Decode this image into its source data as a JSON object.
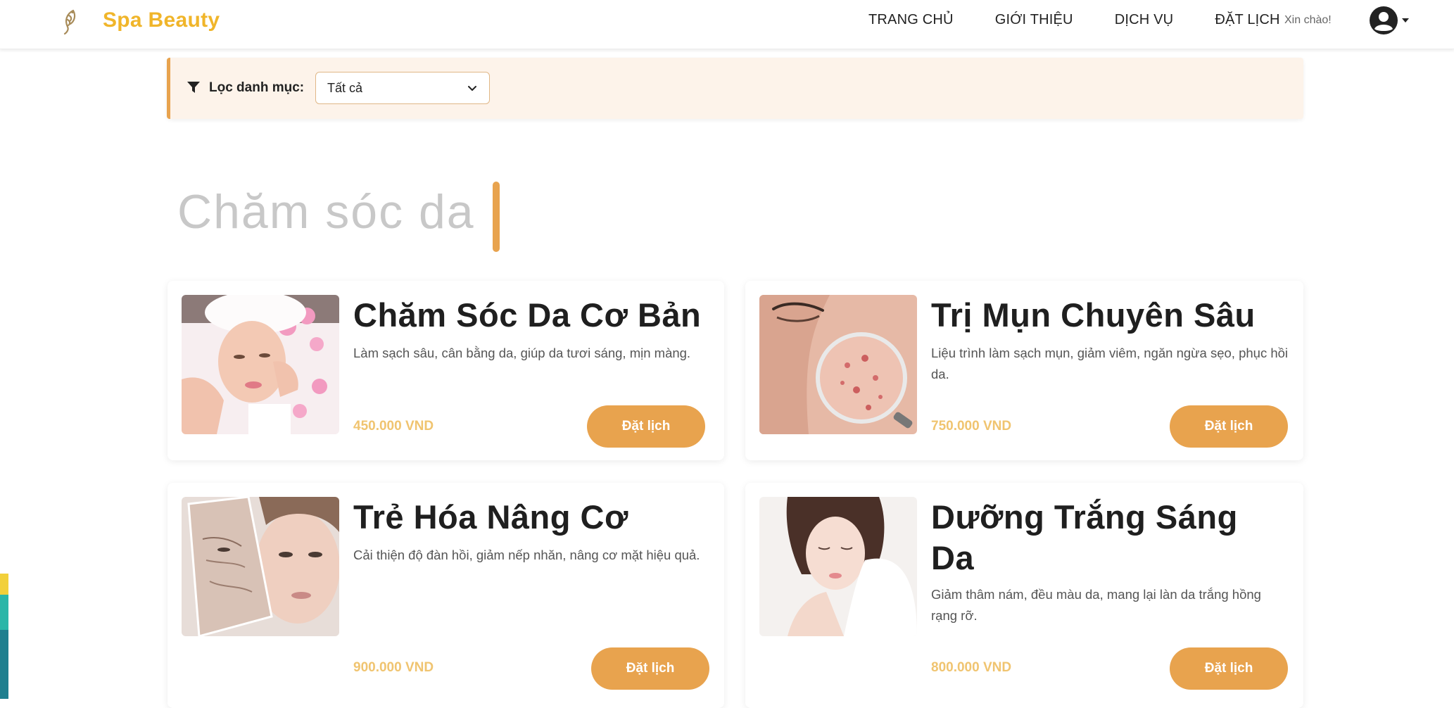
{
  "brand": {
    "name": "Spa Beauty",
    "color": "#f0b52a",
    "icon": "feather-logo-icon"
  },
  "nav": {
    "links": [
      {
        "label": "TRANG CHỦ"
      },
      {
        "label": "GIỚI THIỆU"
      },
      {
        "label": "DỊCH VỤ"
      },
      {
        "label": "ĐẶT LỊCH"
      }
    ],
    "greeting": "Xin chào!",
    "user_icon": "user-circle-icon"
  },
  "filter": {
    "label": "Lọc danh mục:",
    "selected": "Tất cả",
    "icon": "filter-icon",
    "accent": "#e8a34e",
    "background": "#fdf3ea"
  },
  "section": {
    "title": "Chăm sóc da"
  },
  "services": [
    {
      "title": "Chăm Sóc Da Cơ Bản",
      "description": "Làm sạch sâu, cân bằng da, giúp da tươi sáng, mịn màng.",
      "price": "450.000 VND",
      "button": "Đặt lịch",
      "image": "facial-treatment-photo"
    },
    {
      "title": "Trị Mụn Chuyên Sâu",
      "description": "Liệu trình làm sạch mụn, giảm viêm, ngăn ngừa sẹo, phục hồi da.",
      "price": "750.000 VND",
      "button": "Đặt lịch",
      "image": "acne-magnifier-photo"
    },
    {
      "title": "Trẻ Hóa Nâng Cơ",
      "description": "Cải thiện độ đàn hồi, giảm nếp nhăn, nâng cơ mặt hiệu quả.",
      "price": "900.000 VND",
      "button": "Đặt lịch",
      "image": "anti-aging-face-photo"
    },
    {
      "title": "Dưỡng Trắng Sáng Da",
      "description": "Giảm thâm nám, đều màu da, mang lại làn da trắng hồng rạng rỡ.",
      "price": "800.000 VND",
      "button": "Đặt lịch",
      "image": "whitening-skin-photo"
    }
  ],
  "colors": {
    "accent": "#e8a34e",
    "price": "#f0c470",
    "title_gray": "#c8c8c8"
  }
}
